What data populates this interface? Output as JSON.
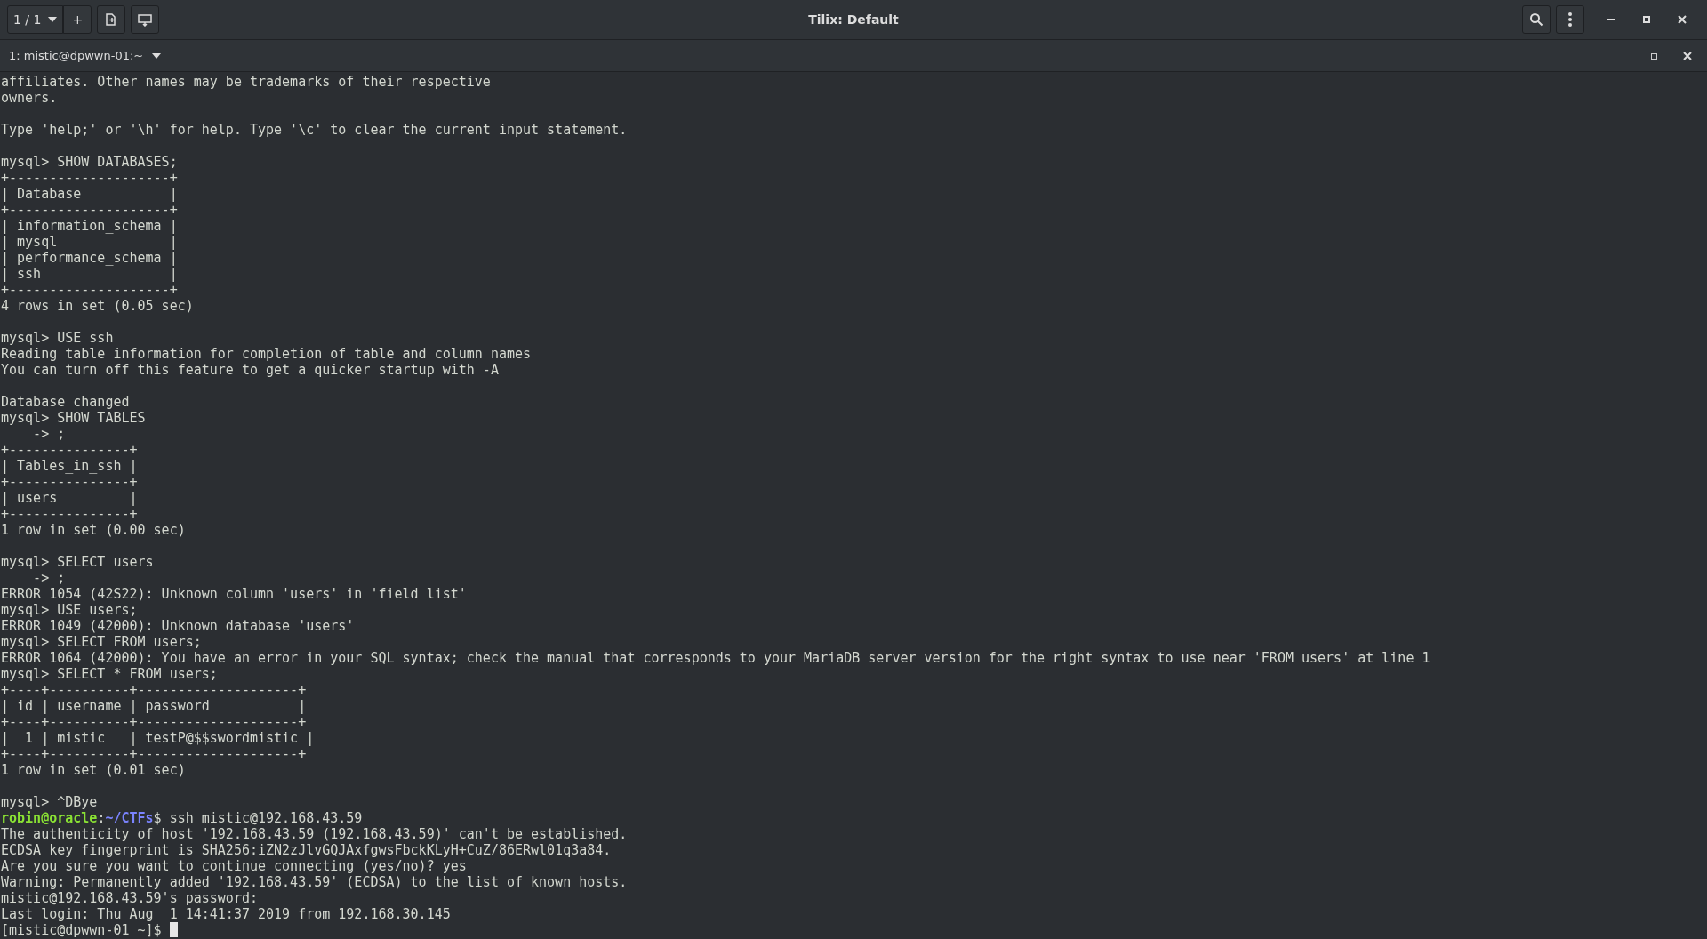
{
  "window": {
    "title": "Tilix: Default",
    "session_button": "1 / 1",
    "add_button": "+"
  },
  "tab": {
    "label": "1: mistic@dpwwn-01:~"
  },
  "terminal": {
    "lines": [
      {
        "kind": "text",
        "text": "affiliates. Other names may be trademarks of their respective"
      },
      {
        "kind": "text",
        "text": "owners."
      },
      {
        "kind": "blank"
      },
      {
        "kind": "text",
        "text": "Type 'help;' or '\\h' for help. Type '\\c' to clear the current input statement."
      },
      {
        "kind": "blank"
      },
      {
        "kind": "text",
        "text": "mysql> SHOW DATABASES;"
      },
      {
        "kind": "text",
        "text": "+--------------------+"
      },
      {
        "kind": "text",
        "text": "| Database           |"
      },
      {
        "kind": "text",
        "text": "+--------------------+"
      },
      {
        "kind": "text",
        "text": "| information_schema |"
      },
      {
        "kind": "text",
        "text": "| mysql              |"
      },
      {
        "kind": "text",
        "text": "| performance_schema |"
      },
      {
        "kind": "text",
        "text": "| ssh                |"
      },
      {
        "kind": "text",
        "text": "+--------------------+"
      },
      {
        "kind": "text",
        "text": "4 rows in set (0.05 sec)"
      },
      {
        "kind": "blank"
      },
      {
        "kind": "text",
        "text": "mysql> USE ssh"
      },
      {
        "kind": "text",
        "text": "Reading table information for completion of table and column names"
      },
      {
        "kind": "text",
        "text": "You can turn off this feature to get a quicker startup with -A"
      },
      {
        "kind": "blank"
      },
      {
        "kind": "text",
        "text": "Database changed"
      },
      {
        "kind": "text",
        "text": "mysql> SHOW TABLES"
      },
      {
        "kind": "text",
        "text": "    -> ;"
      },
      {
        "kind": "text",
        "text": "+---------------+"
      },
      {
        "kind": "text",
        "text": "| Tables_in_ssh |"
      },
      {
        "kind": "text",
        "text": "+---------------+"
      },
      {
        "kind": "text",
        "text": "| users         |"
      },
      {
        "kind": "text",
        "text": "+---------------+"
      },
      {
        "kind": "text",
        "text": "1 row in set (0.00 sec)"
      },
      {
        "kind": "blank"
      },
      {
        "kind": "text",
        "text": "mysql> SELECT users"
      },
      {
        "kind": "text",
        "text": "    -> ;"
      },
      {
        "kind": "text",
        "text": "ERROR 1054 (42S22): Unknown column 'users' in 'field list'"
      },
      {
        "kind": "text",
        "text": "mysql> USE users;"
      },
      {
        "kind": "text",
        "text": "ERROR 1049 (42000): Unknown database 'users'"
      },
      {
        "kind": "text",
        "text": "mysql> SELECT FROM users;"
      },
      {
        "kind": "text",
        "text": "ERROR 1064 (42000): You have an error in your SQL syntax; check the manual that corresponds to your MariaDB server version for the right syntax to use near 'FROM users' at line 1"
      },
      {
        "kind": "text",
        "text": "mysql> SELECT * FROM users;"
      },
      {
        "kind": "text",
        "text": "+----+----------+--------------------+"
      },
      {
        "kind": "text",
        "text": "| id | username | password           |"
      },
      {
        "kind": "text",
        "text": "+----+----------+--------------------+"
      },
      {
        "kind": "text",
        "text": "|  1 | mistic   | testP@$$swordmistic |"
      },
      {
        "kind": "text",
        "text": "+----+----------+--------------------+"
      },
      {
        "kind": "text",
        "text": "1 row in set (0.01 sec)"
      },
      {
        "kind": "blank"
      },
      {
        "kind": "text",
        "text": "mysql> ^DBye"
      },
      {
        "kind": "prompt",
        "user": "robin@oracle",
        "sep": ":",
        "path": "~/CTFs",
        "text": "$ ssh mistic@192.168.43.59"
      },
      {
        "kind": "text",
        "text": "The authenticity of host '192.168.43.59 (192.168.43.59)' can't be established."
      },
      {
        "kind": "text",
        "text": "ECDSA key fingerprint is SHA256:iZN2zJlvGQJAxfgwsFbckKLyH+CuZ/86ERwl01q3a84."
      },
      {
        "kind": "text",
        "text": "Are you sure you want to continue connecting (yes/no)? yes"
      },
      {
        "kind": "text",
        "text": "Warning: Permanently added '192.168.43.59' (ECDSA) to the list of known hosts."
      },
      {
        "kind": "text",
        "text": "mistic@192.168.43.59's password: "
      },
      {
        "kind": "text",
        "text": "Last login: Thu Aug  1 14:41:37 2019 from 192.168.30.145"
      },
      {
        "kind": "text",
        "text": "[mistic@dpwwn-01 ~]$ ",
        "cursor": true
      }
    ]
  }
}
